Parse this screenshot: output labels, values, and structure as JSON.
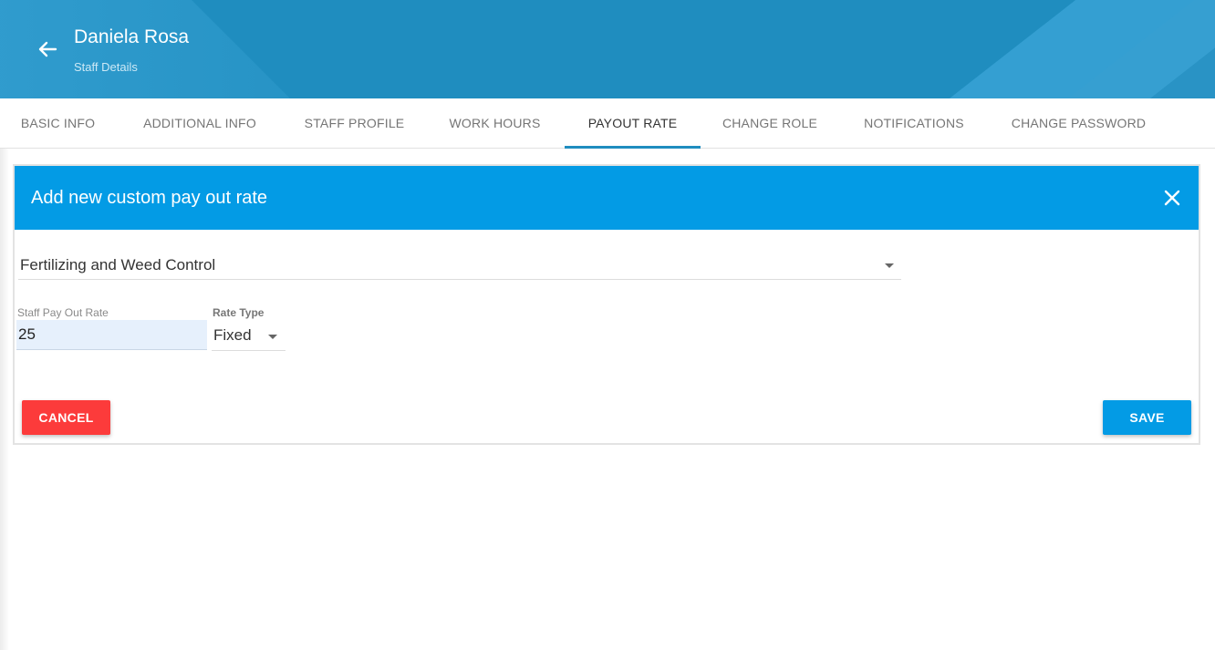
{
  "header": {
    "title": "Daniela Rosa",
    "subtitle": "Staff Details",
    "back_icon": "arrow-left-icon",
    "color": "#1f8dbf"
  },
  "tabs": [
    {
      "label": "BASIC INFO",
      "active": false
    },
    {
      "label": "ADDITIONAL INFO",
      "active": false
    },
    {
      "label": "STAFF PROFILE",
      "active": false
    },
    {
      "label": "WORK HOURS",
      "active": false
    },
    {
      "label": "PAYOUT RATE",
      "active": true
    },
    {
      "label": "CHANGE ROLE",
      "active": false
    },
    {
      "label": "NOTIFICATIONS",
      "active": false
    },
    {
      "label": "CHANGE PASSWORD",
      "active": false
    }
  ],
  "dialog": {
    "title": "Add new custom pay out rate",
    "close_icon": "close-icon",
    "header_color": "#039be5",
    "service": {
      "selected": "Fertilizing and Weed Control"
    },
    "rate": {
      "label": "Staff Pay Out Rate",
      "value": "25"
    },
    "rate_type": {
      "label": "Rate Type",
      "selected": "Fixed"
    },
    "cancel_label": "CANCEL",
    "save_label": "SAVE",
    "cancel_color": "#fc3b3b",
    "save_color": "#039be5"
  }
}
